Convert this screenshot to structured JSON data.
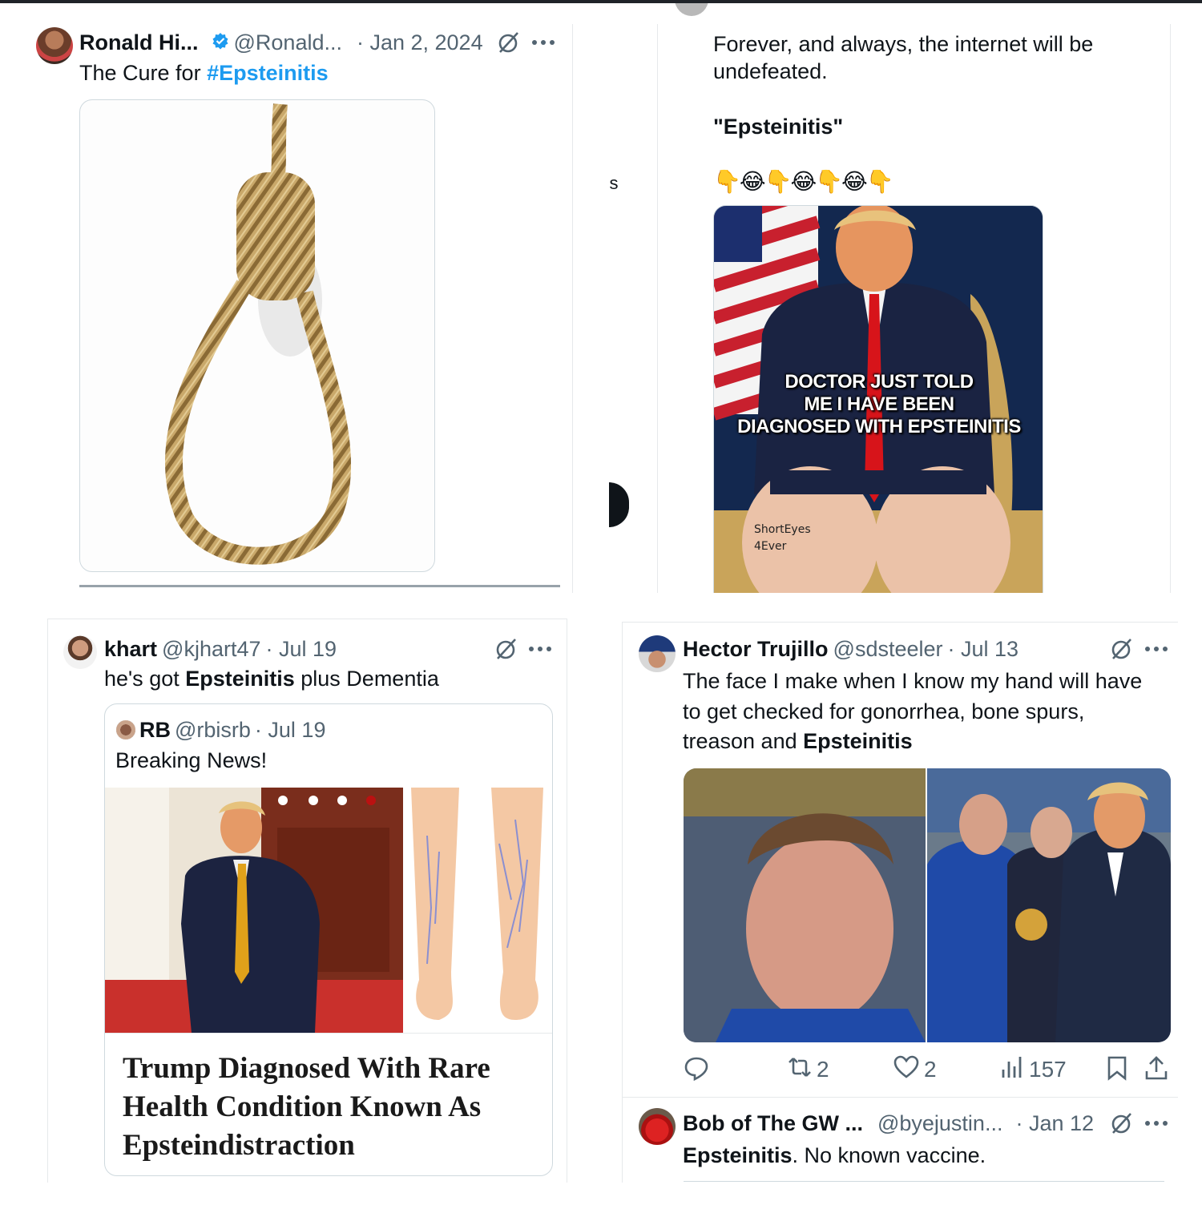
{
  "posts": {
    "ronald": {
      "name": "Ronald Hi...",
      "handle": "@Ronald...",
      "date": "· Jan 2, 2024",
      "text_prefix": "The Cure for ",
      "hashtag": "#Epsteinitis"
    },
    "forever": {
      "line1": "Forever, and always, the internet will be",
      "line2": "undefeated.",
      "quote": "\"Epsteinitis\"",
      "emoji": "👇😂👇😂👇😂👇",
      "meme_caption_1": "DOCTOR JUST TOLD",
      "meme_caption_2": "ME I HAVE BEEN",
      "meme_caption_3": "DIAGNOSED WITH EPSTEINITIS",
      "watermark_1": "ShortEyes",
      "watermark_2": "4Ever"
    },
    "khart": {
      "name": "khart",
      "handle": "@kjhart47",
      "date": "· Jul 19",
      "text_prefix": "he's got ",
      "text_bold": "Epsteinitis",
      "text_suffix": " plus Dementia",
      "quoted": {
        "name": "RB",
        "handle": "@rbisrb",
        "date": "· Jul 19",
        "text": "Breaking News!",
        "headline_1": "Trump Diagnosed With Rare",
        "headline_2": "Health Condition Known As",
        "headline_3": "Epsteindistraction"
      }
    },
    "hector": {
      "name": "Hector Trujillo",
      "handle": "@sdsteeler",
      "date": "· Jul 13",
      "line1": "The face I make when I know my hand will have",
      "line2": "to get checked for gonorrhea, bone spurs,",
      "line3_prefix": "treason and ",
      "line3_bold": "Epsteinitis",
      "reposts": "2",
      "likes": "2",
      "views": "157"
    },
    "bob": {
      "name": "Bob of The GW ...",
      "handle": "@byejustin...",
      "date": "· Jan 12",
      "text_bold": "Epsteinitis",
      "text_suffix": ". No known vaccine."
    }
  },
  "icons": {
    "verified": "verified-badge-icon",
    "grok": "grok-icon",
    "more": "more-icon",
    "reply": "reply-icon",
    "repost": "repost-icon",
    "like": "like-icon",
    "views": "views-icon",
    "bookmark": "bookmark-icon",
    "share": "share-icon"
  },
  "colors": {
    "link": "#1d9bf0",
    "muted": "#536471",
    "text": "#0f1419",
    "verified": "#1d9bf0"
  }
}
